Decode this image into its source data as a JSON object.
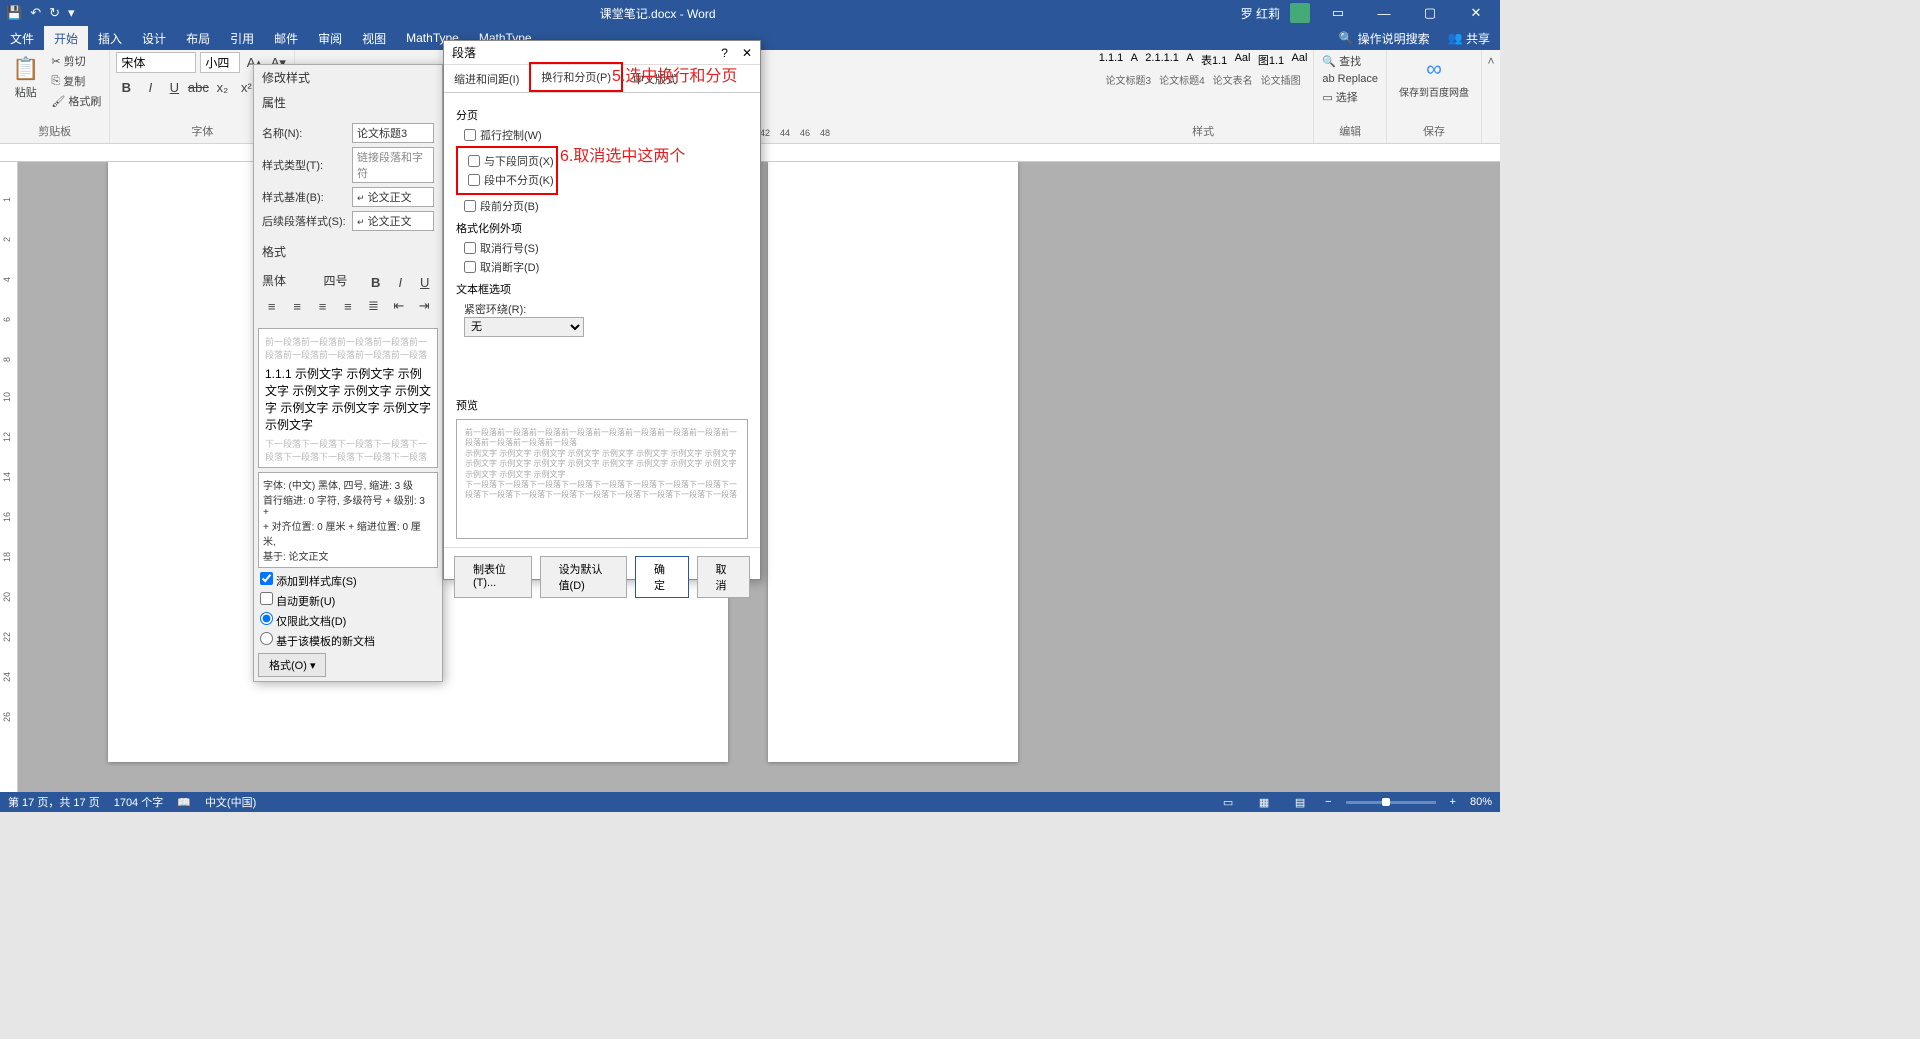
{
  "titlebar": {
    "doc_title": "课堂笔记.docx - Word",
    "user_name": "罗 红莉",
    "qat": {
      "save": "💾",
      "undo": "↶",
      "redo": "↻"
    }
  },
  "tabs": {
    "file": "文件",
    "home": "开始",
    "insert": "插入",
    "design": "设计",
    "layout": "布局",
    "references": "引用",
    "mailings": "邮件",
    "review": "审阅",
    "view": "视图",
    "mathtype1": "MathType",
    "mathtype2": "MathType",
    "search_placeholder": "操作说明搜索",
    "share": "共享"
  },
  "ribbon": {
    "clipboard": {
      "paste": "粘贴",
      "cut": "剪切",
      "copy": "复制",
      "format_painter": "格式刷",
      "group_label": "剪贴板"
    },
    "font": {
      "name": "宋体",
      "size": "小四",
      "group_label": "字体"
    },
    "styles": {
      "s1": "1.1.1",
      "s2": "A",
      "s3": "2.1.1.1",
      "s4": "A",
      "s5": "表1.1",
      "s6": "Aal",
      "s7": "图1.1",
      "s8": "Aal",
      "n1": "论文标题3",
      "n2": "论文标题4",
      "n3": "论文表名",
      "n4": "论文插图",
      "group_label": "样式"
    },
    "editing": {
      "find": "查找",
      "replace": "Replace",
      "select": "选择",
      "group_label": "编辑"
    },
    "save_cloud": {
      "label": "保存到百度网盘",
      "group_label": "保存"
    }
  },
  "modify_style": {
    "dialog_title": "修改样式",
    "section_props": "属性",
    "name_label": "名称(N):",
    "name_value": "论文标题3",
    "type_label": "样式类型(T):",
    "type_value": "链接段落和字符",
    "based_label": "样式基准(B):",
    "based_value": "论文正文",
    "following_label": "后续段落样式(S):",
    "following_value": "论文正文",
    "section_format": "格式",
    "format_font": "黑体",
    "format_size": "四号",
    "preview_heading": "1.1.1 示例文字 示例文字 示例文字 示例文字 示例文字 示例文字 示例文字 示例文字 示例文字 示例文字",
    "desc_line1": "字体: (中文) 黑体, 四号, 缩进: 3 级",
    "desc_line2": "首行缩进: 0 字符, 多级符号 + 级别: 3 +",
    "desc_line3": "+ 对齐位置: 0 厘米 + 缩进位置: 0 厘米,",
    "desc_line4": "基于: 论文正文",
    "add_to_lib": "添加到样式库(S)",
    "auto_update": "自动更新(U)",
    "only_this_doc": "仅限此文档(D)",
    "based_on_template": "基于该模板的新文档",
    "format_btn": "格式(O)"
  },
  "paragraph": {
    "dialog_title": "段落",
    "tab_indent": "缩进和间距(I)",
    "tab_line_page": "换行和分页(P)",
    "tab_chinese": "中文版式",
    "section_pagination": "分页",
    "widow_control": "孤行控制(W)",
    "keep_with_next": "与下段同页(X)",
    "keep_lines_together": "段中不分页(K)",
    "page_break_before": "段前分页(B)",
    "section_format_exceptions": "格式化例外项",
    "suppress_line_numbers": "取消行号(S)",
    "dont_hyphenate": "取消断字(D)",
    "section_textbox": "文本框选项",
    "tight_wrap_label": "紧密环绕(R):",
    "tight_wrap_value": "无",
    "section_preview": "预览",
    "btn_tabs": "制表位(T)...",
    "btn_default": "设为默认值(D)",
    "btn_ok": "确定",
    "btn_cancel": "取消"
  },
  "annotations": {
    "a5": "5.选中换行和分页",
    "a6": "6.取消选中这两个"
  },
  "ruler_marks": {
    "m42": "42",
    "m44": "44",
    "m46": "46",
    "m48": "48"
  },
  "status": {
    "page": "第 17 页，共 17 页",
    "words": "1704 个字",
    "lang": "中文(中国)",
    "zoom": "80%"
  }
}
